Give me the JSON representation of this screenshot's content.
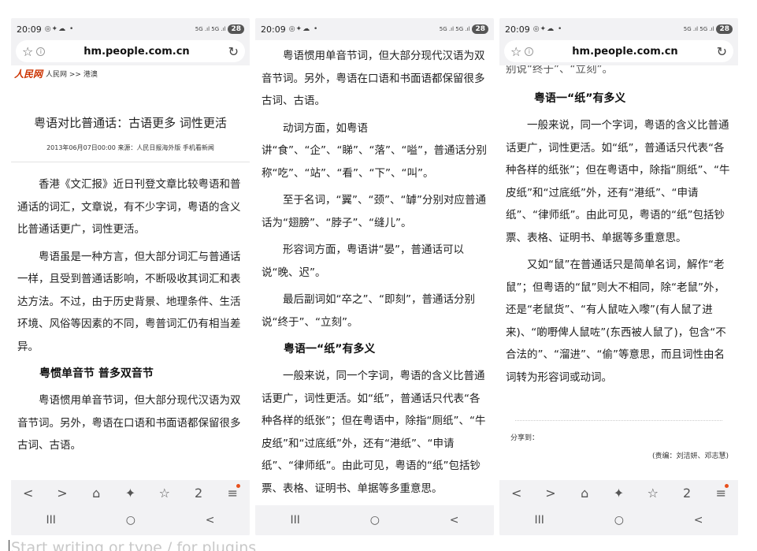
{
  "phones": [
    {
      "status": {
        "time": "20:09",
        "icons": "◎✦☁ •",
        "signal": "5G .ıl 5G .ıl",
        "battery": "28"
      },
      "url": "hm.people.com.cn",
      "logo": "人民网",
      "logo_sub": "people",
      "breadcrumb": "人民网 >> 港澳",
      "title": "粤语对比普通话：古语更多 词性更活",
      "meta": "2013年06月07日00:00   来源：人民日报海外版   手机看新闻",
      "paragraphs": [
        "香港《文汇报》近日刊登文章比较粤语和普通话的词汇，文章说，有不少字词，粤语的含义比普通话更广，词性更活。",
        "粤语虽是一种方言，但大部分词汇与普通话一样，且受到普通话影响，不断吸收其词汇和表达方法。不过，由于历史背景、地理条件、生活环境、风俗等因素的不同，粤普词汇仍有相当差异。"
      ],
      "subtitle": "粤惯单音节 普多双音节",
      "tail_paragraph": "粤语惯用单音节词，但大部分现代汉语为双音节词。另外，粤语在口语和书面语都保留很多古词、古语。"
    },
    {
      "status": {
        "time": "20:09",
        "icons": "◎✦☁ •",
        "signal": "5G .ıl 5G .ıl",
        "battery": "28"
      },
      "paragraphs_a": [
        "粤语惯用单音节词，但大部分现代汉语为双音节词。另外，粤语在口语和书面语都保留很多古词、古语。",
        "动词方面，如粤语讲“食”、“企”、“睇”、“落”、“嗌”，普通话分别称“吃”、“站”、“看”、“下”、“叫”。",
        "至于名词，“翼”、“颈”、“罅”分别对应普通话为“翅膀”、“脖子”、“缝儿”。",
        "形容词方面，粤语讲“晏”，普通话可以说“晚、迟”。",
        "最后副词如“卒之”、“即刻”，普通话分别说“终于”、“立刻”。"
      ],
      "subtitle": "粤语一“纸”有多义",
      "paragraph_b": "一般来说，同一个字词，粤语的含义比普通话更广，词性更活。如“纸”，普通话只代表“各种各样的纸张”；但在粤语中，除指“厕纸”、“牛皮纸”和“过底纸”外，还有“港纸”、“申请纸”、“律师纸”。由此可见，粤语的“纸”包括钞票、表格、证明书、单据等多重意思。"
    },
    {
      "status": {
        "time": "20:09",
        "icons": "◎✦☁ •",
        "signal": "5G .ıl 5G .ıl",
        "battery": "28"
      },
      "url": "hm.people.com.cn",
      "clip_top": "别说“终于”、“立刻”。",
      "subtitle": "粤语一“纸”有多义",
      "paragraphs": [
        "一般来说，同一个字词，粤语的含义比普通话更广，词性更活。如“纸”，普通话只代表“各种各样的纸张”；但在粤语中，除指“厕纸”、“牛皮纸”和“过底纸”外，还有“港纸”、“申请纸”、“律师纸”。由此可见，粤语的“纸”包括钞票、表格、证明书、单据等多重意思。",
        "又如“鼠”在普通话只是简单名词，解作“老鼠”；但粤语的“鼠”则大不相同，除“老鼠”外，还是“老鼠货”、“有人鼠咗入嚟”(有人鼠了进来)、“啲嘢俾人鼠咗”(东西被人鼠了)，包含“不合法的”、“溜进”、“偷”等意思，而且词性由名词转为形容词或动词。"
      ],
      "share": "分享到：",
      "editor": "(责编：刘洁妍、邓志慧)"
    }
  ],
  "toolbar_icons": [
    "<",
    ">",
    "⌂",
    "✦",
    "☆",
    "2",
    "≡"
  ],
  "nav_icons": [
    "III",
    "○",
    "<"
  ],
  "editor_placeholder": "Start writing or type / for plugins"
}
